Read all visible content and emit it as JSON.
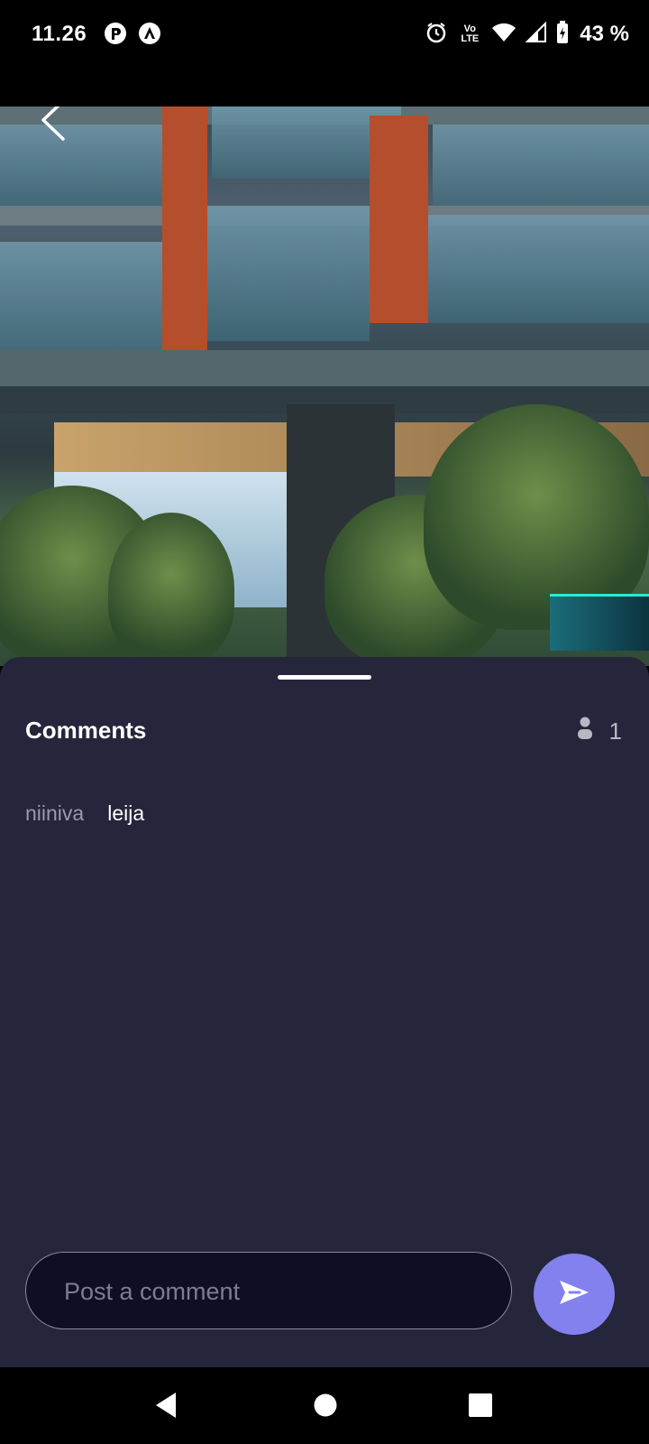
{
  "status_bar": {
    "time": "11.26",
    "network_label": "Vo LTE",
    "battery": "43 %",
    "icons": [
      "app-notification-icon",
      "app-notification-icon-2",
      "alarm-icon",
      "volte-icon",
      "wifi-icon",
      "signal-icon",
      "battery-icon"
    ]
  },
  "video": {
    "back_icon": "chevron-left-icon"
  },
  "comments_sheet": {
    "title": "Comments",
    "viewer_icon": "person-icon",
    "viewer_count": "1",
    "comments": [
      {
        "user": "niiniva",
        "text": "leija"
      }
    ],
    "input_placeholder": "Post a comment",
    "send_icon": "send-icon",
    "accent_color": "#8381ee",
    "background_color": "#25253b"
  },
  "nav_bar": {
    "icons": [
      "back-triangle-icon",
      "home-circle-icon",
      "recents-square-icon"
    ]
  }
}
